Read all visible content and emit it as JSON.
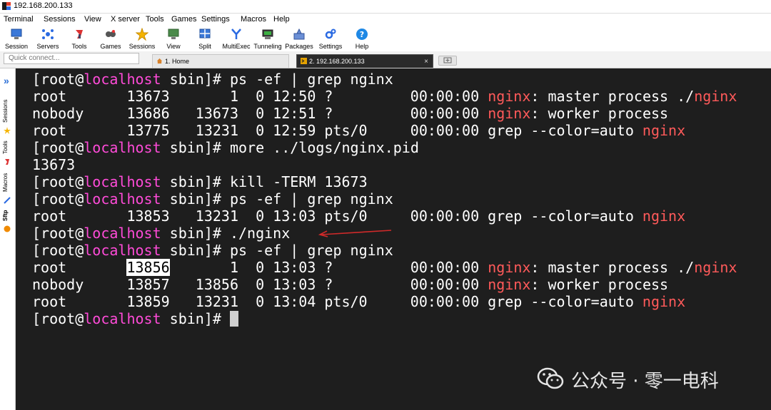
{
  "window": {
    "title": "192.168.200.133"
  },
  "menu": [
    "Terminal",
    "Sessions",
    "View",
    "X server",
    "Tools",
    "Games",
    "Settings",
    "Macros",
    "Help"
  ],
  "toolbar": [
    {
      "label": "Session",
      "icon": "session-icon"
    },
    {
      "label": "Servers",
      "icon": "servers-icon"
    },
    {
      "label": "Tools",
      "icon": "tools-icon"
    },
    {
      "label": "Games",
      "icon": "games-icon"
    },
    {
      "label": "Sessions",
      "icon": "star-icon"
    },
    {
      "label": "View",
      "icon": "view-icon"
    },
    {
      "label": "Split",
      "icon": "split-icon"
    },
    {
      "label": "MultiExec",
      "icon": "multiexec-icon"
    },
    {
      "label": "Tunneling",
      "icon": "tunneling-icon"
    },
    {
      "label": "Packages",
      "icon": "packages-icon"
    },
    {
      "label": "Settings",
      "icon": "gear-icon"
    },
    {
      "label": "Help",
      "icon": "help-icon"
    }
  ],
  "quick_connect": {
    "placeholder": "Quick connect..."
  },
  "tabs": [
    {
      "label": "1. Home",
      "icon": "home-icon"
    },
    {
      "label": "2. 192.168.200.133",
      "icon": "terminal-icon",
      "close": "×"
    }
  ],
  "side_tabs": [
    "Sessions",
    "Tools",
    "Macros",
    "Sftp"
  ],
  "side_expand": "»",
  "prompt": {
    "open": "[root@",
    "host": "localhost",
    "dir": " sbin]# "
  },
  "terminal": {
    "cmd1": "ps -ef | grep nginx",
    "r1": {
      "pre": "root       13673       1  0 12:50 ?         00:00:00 ",
      "hl1": "nginx",
      "mid": ": master process ./",
      "hl2": "nginx"
    },
    "r2": {
      "pre": "nobody     13686   13673  0 12:51 ?         00:00:00 ",
      "hl1": "nginx",
      "mid": ": worker process"
    },
    "r3": {
      "pre": "root       13775   13231  0 12:59 pts/0     00:00:00 grep --color=auto ",
      "hl": "nginx"
    },
    "cmd2": "more ../logs/nginx.pid",
    "out_pid": "13673",
    "cmd3": "kill -TERM 13673",
    "cmd4": "ps -ef | grep nginx",
    "r4": {
      "pre": "root       13853   13231  0 13:03 pts/0     00:00:00 grep --color=auto ",
      "hl": "nginx"
    },
    "cmd5": "./nginx",
    "cmd6": "ps -ef | grep nginx",
    "r5": {
      "a": "root       ",
      "sel": "13856",
      "b": "       1  0 13:03 ?         00:00:00 ",
      "hl1": "nginx",
      "mid": ": master process ./",
      "hl2": "nginx"
    },
    "r6": {
      "pre": "nobody     13857   13856  0 13:03 ?         00:00:00 ",
      "hl1": "nginx",
      "mid": ": worker process"
    },
    "r7": {
      "pre": "root       13859   13231  0 13:04 pts/0     00:00:00 grep --color=auto ",
      "hl": "nginx"
    }
  },
  "watermark": "公众号 · 零一电科",
  "colors": {
    "terminal_bg": "#1e1e1e",
    "host": "#ff4bd8",
    "match": "#ff5a5a",
    "active_tab": "#2a2a2a",
    "accent": "#2b6fd6"
  }
}
